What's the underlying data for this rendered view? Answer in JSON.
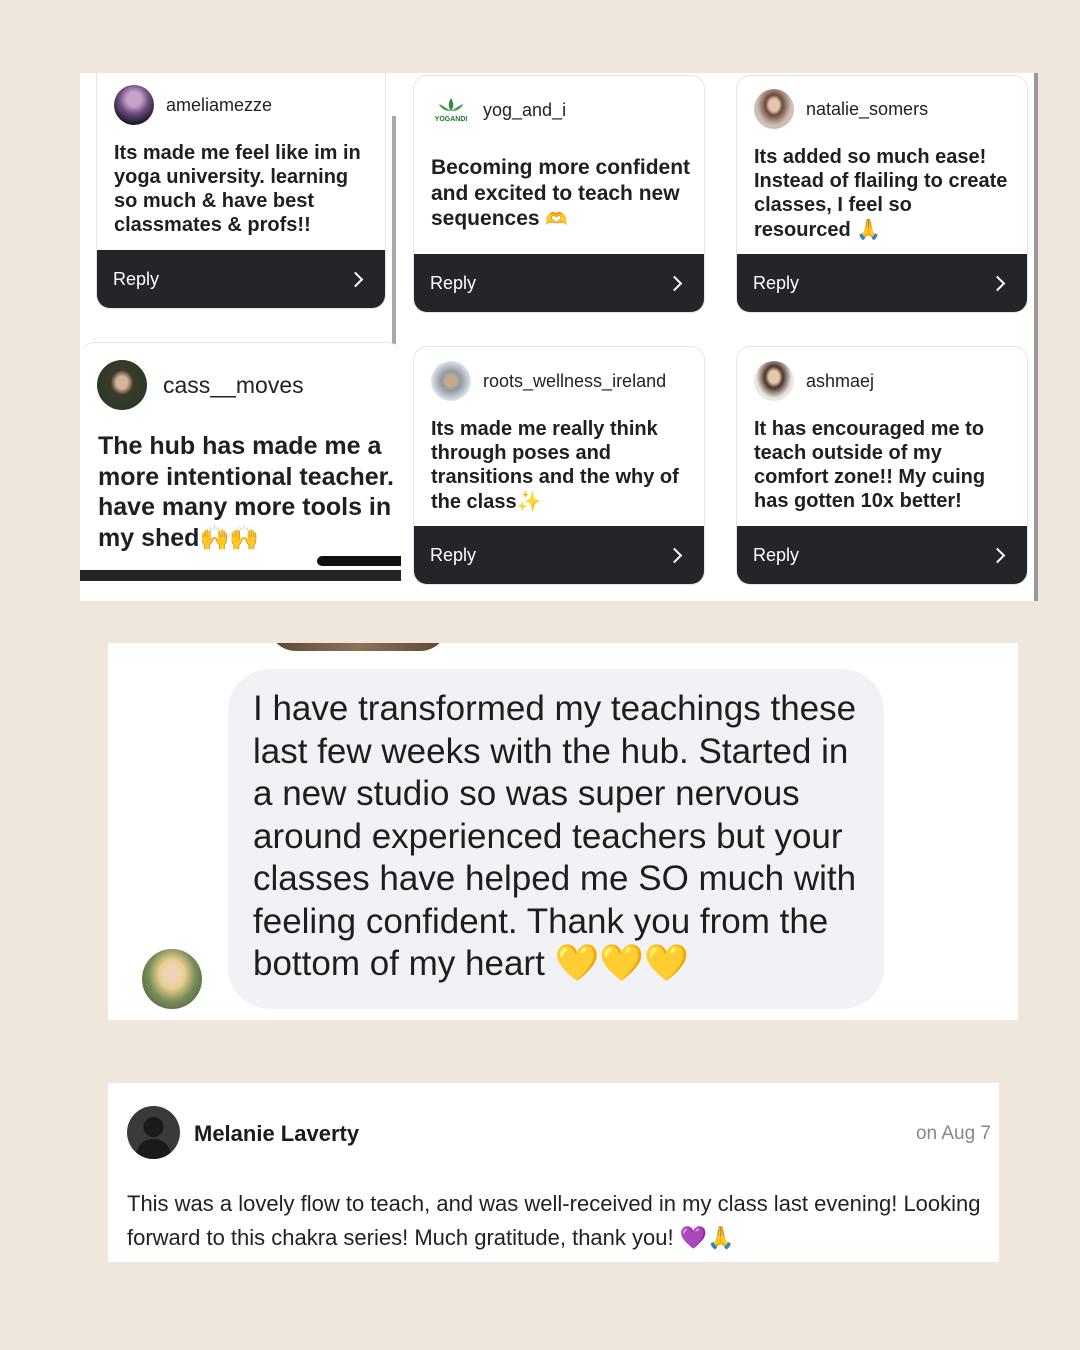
{
  "colors": {
    "background": "#f0e7dc",
    "reply_bar": "#23252a",
    "bubble": "#f1f2f5",
    "heart_yellow": "#ffcc22",
    "heart_purple": "#a35ee8"
  },
  "story_replies": [
    {
      "username": "ameliamezze",
      "message": "Its made me feel like im in yoga university. learning so much & have best classmates & profs!!",
      "reply_label": "Reply",
      "avatar_icon": "user-photo-avatar"
    },
    {
      "username": "yog_and_i",
      "message": "Becoming more confident and excited to teach new sequences",
      "emoji": "🫶",
      "reply_label": "Reply",
      "avatar_icon": "yogandi-logo",
      "logo_text": "YOGANDI"
    },
    {
      "username": "natalie_somers",
      "message": "Its added so much ease! Instead of flailing to create classes, I feel so resourced",
      "emoji": "🙏",
      "reply_label": "Reply",
      "avatar_icon": "user-photo-avatar"
    },
    {
      "username": "cass__moves",
      "message": "The hub has made me a more intentional teacher. have many more tools in my shed",
      "emoji": "🙌🙌",
      "avatar_icon": "user-photo-avatar"
    },
    {
      "username": "roots_wellness_ireland",
      "message": "Its made me really think through poses and transitions and the why of the class",
      "emoji": "✨",
      "reply_label": "Reply",
      "avatar_icon": "user-photo-avatar"
    },
    {
      "username": "ashmaej",
      "message": "It has encouraged me to teach outside of my comfort zone!! My cuing has gotten 10x better!",
      "reply_label": "Reply",
      "avatar_icon": "user-photo-avatar"
    }
  ],
  "message_bubble": {
    "text": "I have transformed my teachings these last few weeks with the hub. Started in a new studio so was super nervous around experienced teachers but your classes have helped me SO much with feeling confident. Thank you from the bottom of my heart",
    "emoji": "💛💛💛",
    "avatar_icon": "user-photo-avatar"
  },
  "comment": {
    "name": "Melanie Laverty",
    "date": "on Aug 7",
    "text": "This was a lovely flow to teach, and was well-received in my class last evening! Looking forward to this chakra series! Much gratitude, thank you!",
    "emoji_heart": "💜",
    "emoji_pray": "🙏",
    "avatar_icon": "default-user-silhouette-icon"
  }
}
